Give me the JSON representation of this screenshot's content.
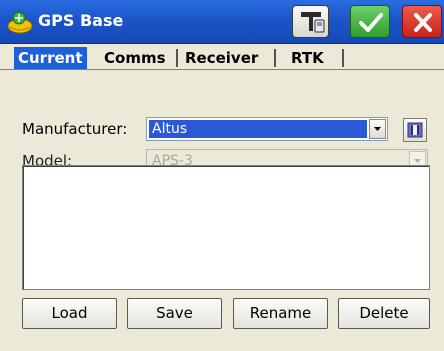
{
  "window": {
    "title": "GPS Base"
  },
  "titlebar_buttons": {
    "survey_icon": "antenna-survey-icon",
    "ok_icon": "checkmark-icon",
    "close_icon": "close-icon"
  },
  "tabs": [
    {
      "label": "Current",
      "active": true
    },
    {
      "label": "Comms",
      "active": false
    },
    {
      "label": "Receiver",
      "active": false
    },
    {
      "label": "RTK",
      "active": false
    }
  ],
  "form": {
    "manufacturer_label": "Manufacturer:",
    "manufacturer_value": "Altus",
    "model_label": "Model:",
    "model_value": "APS-3"
  },
  "buttons": {
    "load": "Load",
    "save": "Save",
    "rename": "Rename",
    "delete": "Delete"
  },
  "colors": {
    "titlebar": "#1c55c9",
    "active_tab": "#1e60d9",
    "selection": "#2b59d6",
    "ok_green": "#2e9e2a",
    "close_red": "#c82219"
  }
}
